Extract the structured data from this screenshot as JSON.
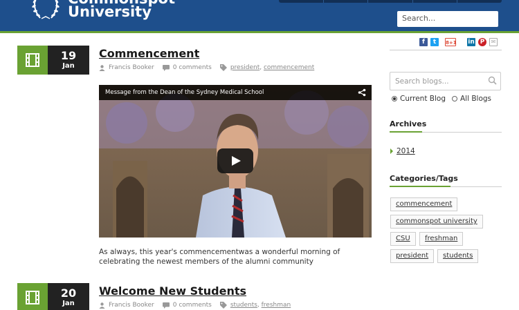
{
  "header": {
    "university_top": "Commonspot",
    "university_name": "University",
    "search_placeholder": "Search..."
  },
  "social": [
    "facebook-icon",
    "twitter-icon",
    "google-plus-icon",
    "linkedin-icon",
    "pinterest-icon",
    "email-icon"
  ],
  "posts": [
    {
      "day": "19",
      "month": "Jan",
      "title": "Commencement",
      "author": "Francis Booker",
      "comments": "0 comments",
      "tags": [
        "president",
        "commencement"
      ],
      "video_title": "Message from the Dean of the Sydney Medical School",
      "excerpt": "As always, this year's commencementwas a wonderful morning of celebrating the newest members of the alumni community"
    },
    {
      "day": "20",
      "month": "Jan",
      "title": "Welcome New Students",
      "author": "Francis Booker",
      "comments": "0 comments",
      "tags": [
        "students",
        "freshman"
      ]
    }
  ],
  "sidebar": {
    "search_placeholder": "Search blogs...",
    "radio_current": "Current Blog",
    "radio_all": "All Blogs",
    "archives_heading": "Archives",
    "archives": [
      "2014"
    ],
    "categories_heading": "Categories/Tags",
    "tags": [
      "commencement",
      "commonspot university",
      "CSU",
      "freshman",
      "president",
      "students"
    ]
  },
  "colors": {
    "header_blue": "#1e4f8c",
    "accent_green": "#6aa233",
    "date_dark": "#222222"
  }
}
